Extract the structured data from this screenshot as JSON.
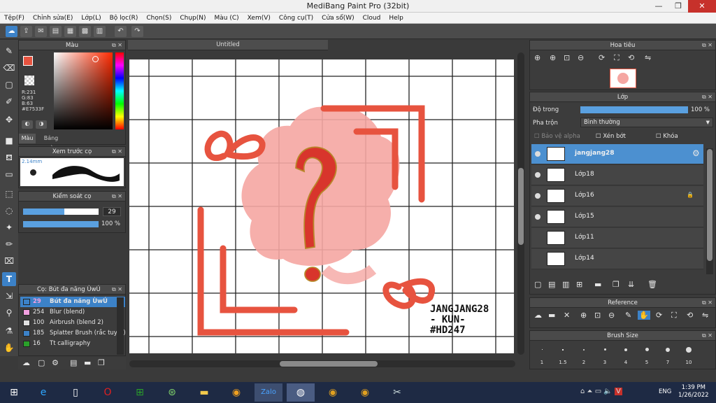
{
  "window": {
    "title": "MediBang Paint Pro (32bit)"
  },
  "menu": [
    "Tệp(F)",
    "Chỉnh sửa(E)",
    "Lớp(L)",
    "Bộ lọc(R)",
    "Chọn(S)",
    "Chụp(N)",
    "Màu (C)",
    "Xem(V)",
    "Công cụ(T)",
    "Cửa sổ(W)",
    "Cloud",
    "Help"
  ],
  "color_panel": {
    "title": "Màu",
    "r": "R:231",
    "g": "G:83",
    "b": "B:63",
    "hex": "#E7533F",
    "tab_color": "Màu",
    "tab_palette": "Bảng màu",
    "fg": "#E7533F"
  },
  "preview_panel": {
    "title": "Xem trước cọ",
    "size": "2.14mm"
  },
  "brush_control": {
    "title": "Kiểm soát cọ",
    "size": "29",
    "size_fraction": 0.55,
    "opacity": "100 %",
    "opacity_fraction": 1.0
  },
  "brush_list": {
    "title": "Cọ: Bút đa năng ÙwÚ",
    "items": [
      {
        "num": "29",
        "label": "Bút đa năng ÙwÚ",
        "color": "#3c82c8"
      },
      {
        "num": "254",
        "label": "Blur (blend)",
        "color": "#f2a0e0"
      },
      {
        "num": "100",
        "label": "Airbrush (blend 2)",
        "color": "#e0e0e0"
      },
      {
        "num": "185",
        "label": "Splatter Brush (rắc tuyết)",
        "color": "#3c82c8"
      },
      {
        "num": "16",
        "label": "Tt calligraphy",
        "color": "#2aa02a"
      }
    ]
  },
  "document": {
    "tab": "Untitled",
    "signature": [
      "JANGJANG28",
      "- KUN-",
      "#HD247"
    ]
  },
  "navigator": {
    "title": "Hoa tiêu"
  },
  "layer_panel": {
    "title": "Lớp",
    "opacity_label": "Độ trong",
    "opacity": "100 %",
    "opacity_fraction": 1.0,
    "blend_label": "Pha trộn",
    "blend_value": "Bình thường",
    "protect_alpha": "Bảo vệ alpha",
    "clip": "Xén bớt",
    "lock": "Khóa",
    "layers": [
      "jangjang28",
      "Lớp18",
      "Lớp16",
      "Lớp15",
      "Lớp11",
      "Lớp14"
    ]
  },
  "reference": {
    "title": "Reference"
  },
  "brush_size": {
    "title": "Brush Size",
    "values": [
      "1",
      "1.5",
      "2",
      "3",
      "4",
      "5",
      "7",
      "10"
    ]
  },
  "taskbar": {
    "lang": "ENG",
    "time": "1:39 PM",
    "date": "1/26/2022"
  }
}
